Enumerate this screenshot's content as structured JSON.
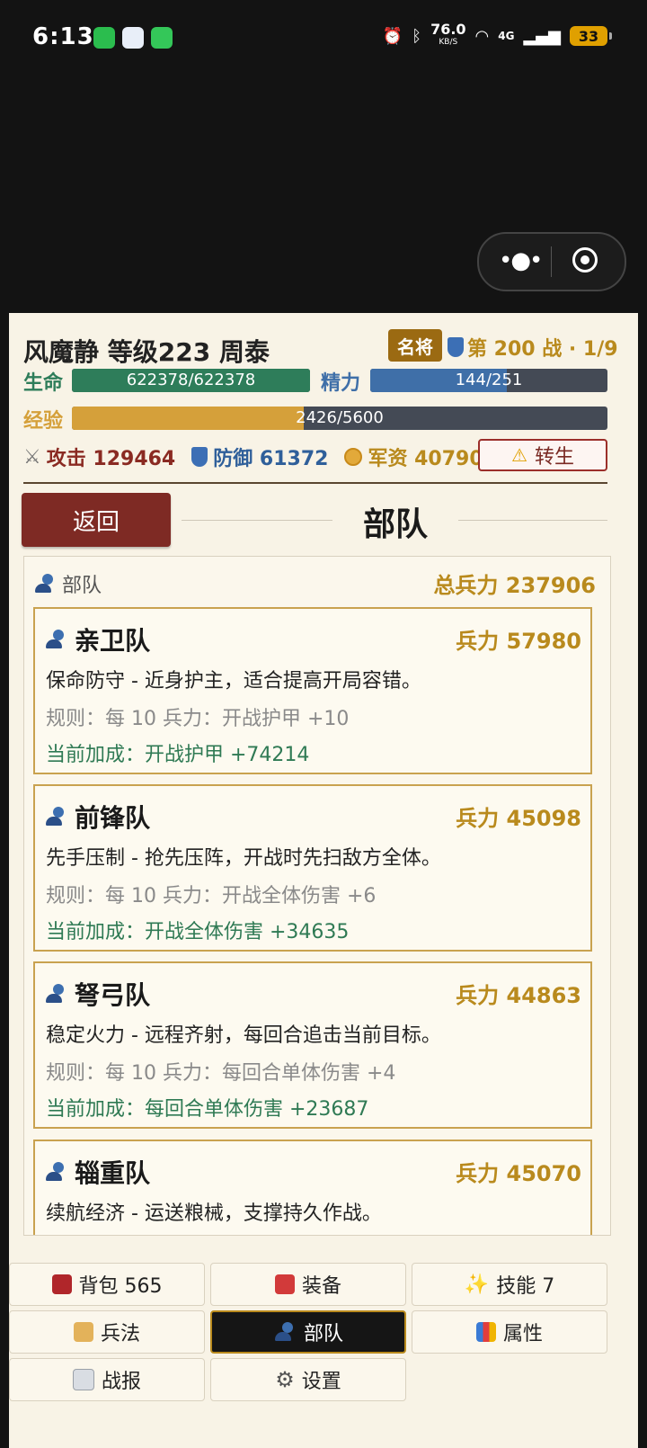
{
  "status_bar": {
    "time": "6:13",
    "speed_value": "76.0",
    "speed_unit": "KB/S",
    "network": "4G",
    "battery": "33"
  },
  "header": {
    "title": "风魔静 等级223 周泰",
    "rank_badge": "名将",
    "battle": "第 200 战 · 1/9",
    "hp_label": "生命",
    "hp_text": "622378/622378",
    "hp_fraction": 1.0,
    "energy_label": "精力",
    "energy_text": "144/251",
    "energy_fraction": 0.574,
    "exp_label": "经验",
    "exp_text": "2426/5600",
    "exp_fraction": 0.433,
    "attack": "攻击 129464",
    "defense": "防御 61372",
    "funds": "军资 40790",
    "rebirth": "转生"
  },
  "page": {
    "back": "返回",
    "title": "部队"
  },
  "panel": {
    "label": "部队",
    "total": "总兵力 237906",
    "cards": [
      {
        "name": "亲卫队",
        "troops": "兵力 57980",
        "desc": "保命防守 - 近身护主，适合提高开局容错。",
        "rule": "规则：每 10 兵力：开战护甲 +10",
        "bonus": "当前加成：开战护甲 +74214"
      },
      {
        "name": "前锋队",
        "troops": "兵力 45098",
        "desc": "先手压制 - 抢先压阵，开战时先扫敌方全体。",
        "rule": "规则：每 10 兵力：开战全体伤害 +6",
        "bonus": "当前加成：开战全体伤害 +34635"
      },
      {
        "name": "弩弓队",
        "troops": "兵力 44863",
        "desc": "稳定火力 - 远程齐射，每回合追击当前目标。",
        "rule": "规则：每 10 兵力：每回合单体伤害 +4",
        "bonus": "当前加成：每回合单体伤害 +23687"
      },
      {
        "name": "辎重队",
        "troops": "兵力 45070",
        "desc": "续航经济 - 运送粮械，支撑持久作战。",
        "rule": "",
        "bonus": ""
      }
    ]
  },
  "nav": {
    "bag": "背包 565",
    "equip": "装备",
    "skills": "技能 7",
    "tactics": "兵法",
    "troops": "部队",
    "attrs": "属性",
    "report": "战报",
    "settings": "设置"
  },
  "colors": {
    "hp": "#2e7d5a",
    "energy": "#3f6fa8",
    "exp": "#d5a03a",
    "gold": "#b98a1d",
    "maroon": "#7e2a24"
  }
}
